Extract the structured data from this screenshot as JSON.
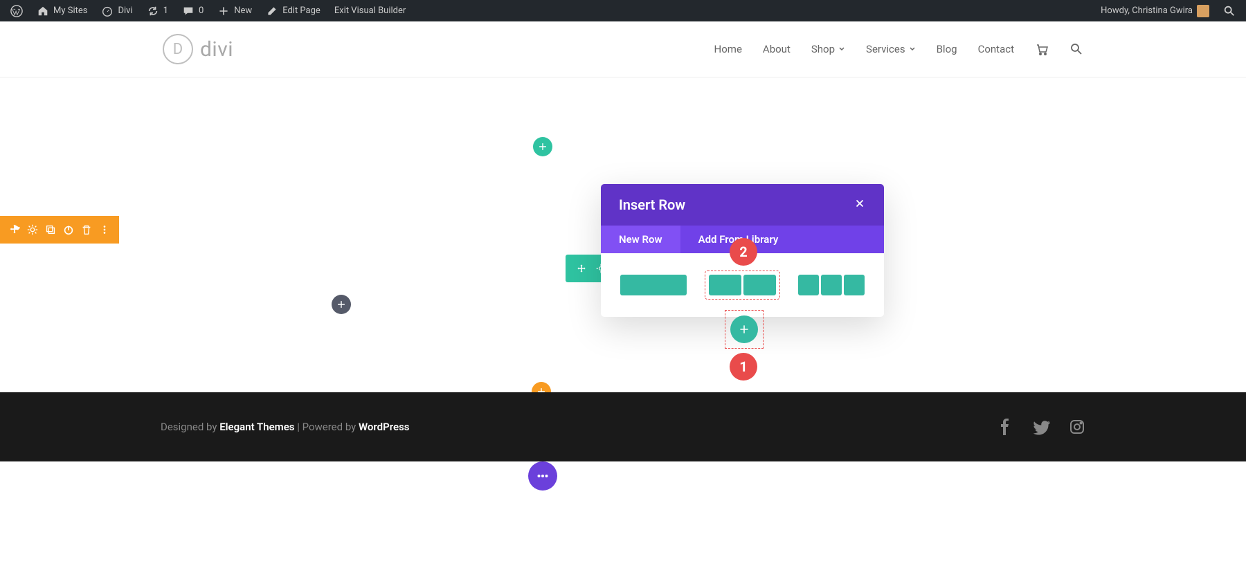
{
  "admin_bar": {
    "my_sites": "My Sites",
    "site_name": "Divi",
    "updates": "1",
    "comments": "0",
    "new": "New",
    "edit_page": "Edit Page",
    "exit_vb": "Exit Visual Builder",
    "howdy": "Howdy, Christina Gwira"
  },
  "header": {
    "logo_letter": "D",
    "logo_text": "divi",
    "nav": {
      "home": "Home",
      "about": "About",
      "shop": "Shop",
      "services": "Services",
      "blog": "Blog",
      "contact": "Contact"
    }
  },
  "toolbar_icons": {
    "move": "move",
    "settings": "settings",
    "copy": "duplicate",
    "save": "save",
    "delete": "delete",
    "more": "more"
  },
  "insert_row": {
    "title": "Insert Row",
    "tab_new": "New Row",
    "tab_library": "Add From Library"
  },
  "markers": {
    "one": "1",
    "two": "2"
  },
  "footer": {
    "designed_by": "Designed by ",
    "elegant": "Elegant Themes",
    "sep": " | Powered by ",
    "wp": "WordPress"
  }
}
